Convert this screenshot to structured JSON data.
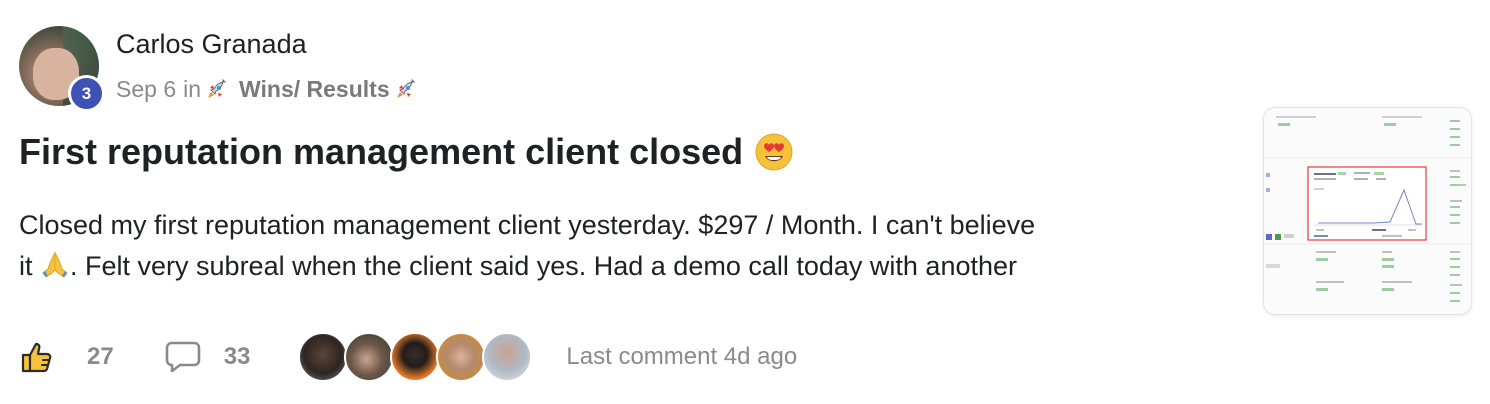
{
  "post": {
    "author": {
      "name": "Carlos Granada",
      "level": "3",
      "avatar": "author-avatar"
    },
    "meta": {
      "date": "Sep 6",
      "in_word": "in",
      "category": "Wins/ Results",
      "category_icon": "rocket-icon"
    },
    "title": "First reputation management client closed",
    "title_emoji": "heart-eyes-emoji",
    "body": {
      "line1": "Closed my first reputation management client yesterday. $297 / Month. I can't believe",
      "line2_start": "it",
      "line2_emoji": "folded-hands-emoji",
      "line2_rest": ". Felt very subreal when the client said yes. Had a demo call today with another"
    },
    "thumbnail": "dashboard-screenshot-thumbnail",
    "footer": {
      "likes": "27",
      "comments": "33",
      "commenter_avatars": [
        "avatar-1",
        "avatar-2",
        "avatar-3",
        "avatar-4",
        "avatar-5"
      ],
      "last_comment": "Last comment 4d ago"
    }
  },
  "colors": {
    "level_badge": "#3f51b5",
    "muted_text": "#8a8a8a",
    "main_text": "#202124",
    "thumb_highlight": "#e53935",
    "thumb_accent": "#4caf50"
  }
}
